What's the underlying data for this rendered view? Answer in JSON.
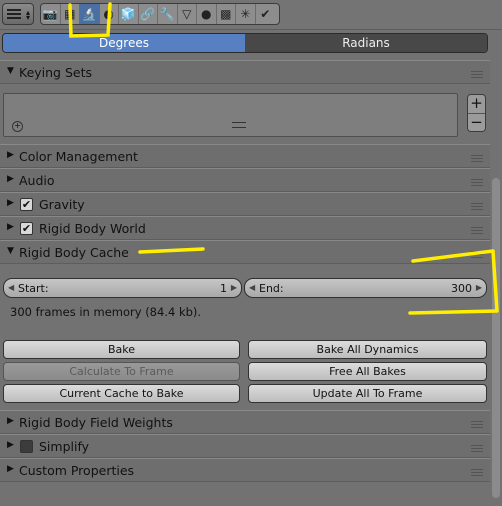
{
  "tabs": [
    "📷",
    "▦",
    "🔬",
    "◐",
    "🧊",
    "🔗",
    "🔧",
    "▽",
    "●",
    "▩",
    "✳",
    "✔"
  ],
  "units": {
    "degrees": "Degrees",
    "radians": "Radians"
  },
  "panels": {
    "keying_sets": "Keying Sets",
    "color_management": "Color Management",
    "audio": "Audio",
    "gravity": "Gravity",
    "rigid_body_world": "Rigid Body World",
    "rigid_body_cache": "Rigid Body Cache",
    "rigid_body_field_weights": "Rigid Body Field Weights",
    "simplify": "Simplify",
    "custom_properties": "Custom Properties"
  },
  "cache": {
    "start_label": "Start:",
    "start_value": "1",
    "end_label": "End:",
    "end_value": "300",
    "info": "300 frames in memory (84.4 kb)."
  },
  "buttons": {
    "bake": "Bake",
    "bake_all_dynamics": "Bake All Dynamics",
    "calculate_to_frame": "Calculate To Frame",
    "free_all_bakes": "Free All Bakes",
    "current_cache_to_bake": "Current Cache to Bake",
    "update_all_to_frame": "Update All To Frame"
  },
  "icons": {
    "expanded": "▼",
    "collapsed": "▶",
    "check": "✔",
    "add": "+",
    "remove": "−"
  }
}
